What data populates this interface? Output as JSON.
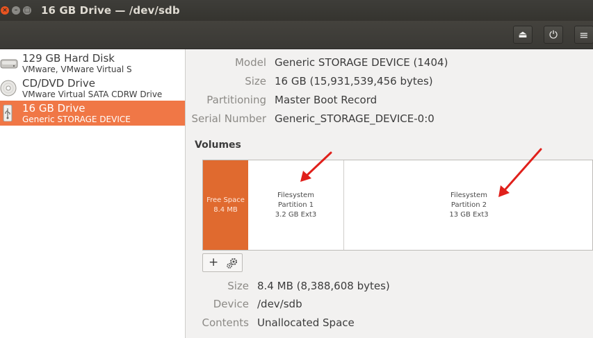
{
  "window": {
    "title": "16 GB Drive — /dev/sdb",
    "buttons": {
      "close": "×",
      "minimize": "–",
      "maximize": "□"
    }
  },
  "header": {
    "buttons": [
      {
        "name": "eject",
        "glyph": "⏏"
      },
      {
        "name": "power",
        "glyph": "⏻"
      },
      {
        "name": "menu",
        "glyph": "≡"
      }
    ]
  },
  "sidebar": {
    "drives": [
      {
        "name": "129 GB Hard Disk",
        "sub": "VMware, VMware Virtual S",
        "icon": "hard-disk-icon",
        "selected": false
      },
      {
        "name": "CD/DVD Drive",
        "sub": "VMware Virtual SATA CDRW Drive",
        "icon": "optical-disc-icon",
        "selected": false
      },
      {
        "name": "16 GB Drive",
        "sub": "Generic STORAGE DEVICE",
        "icon": "usb-drive-icon",
        "selected": true
      }
    ]
  },
  "drive_info": {
    "model_label": "Model",
    "model": "Generic STORAGE DEVICE (1404)",
    "size_label": "Size",
    "size": "16 GB (15,931,539,456 bytes)",
    "partitioning_label": "Partitioning",
    "partitioning": "Master Boot Record",
    "serial_label": "Serial Number",
    "serial": "Generic_STORAGE_DEVICE-0:0"
  },
  "volumes": {
    "heading": "Volumes",
    "items": [
      {
        "line1": "Free Space",
        "line2": "8.4 MB",
        "line3": ""
      },
      {
        "line1": "Filesystem",
        "line2": "Partition 1",
        "line3": "3.2 GB Ext3"
      },
      {
        "line1": "Filesystem",
        "line2": "Partition 2",
        "line3": "13 GB Ext3"
      }
    ],
    "toolbar": {
      "add": "+",
      "settings_icon": "gears-icon"
    }
  },
  "volume_info": {
    "size_label": "Size",
    "size": "8.4 MB (8,388,608 bytes)",
    "device_label": "Device",
    "device": "/dev/sdb",
    "contents_label": "Contents",
    "contents": "Unallocated Space"
  },
  "colors": {
    "accent": "#f07746",
    "free_space": "#e06a2f",
    "annotation_arrow": "#e0201b",
    "titlebar": "#3a3935"
  }
}
